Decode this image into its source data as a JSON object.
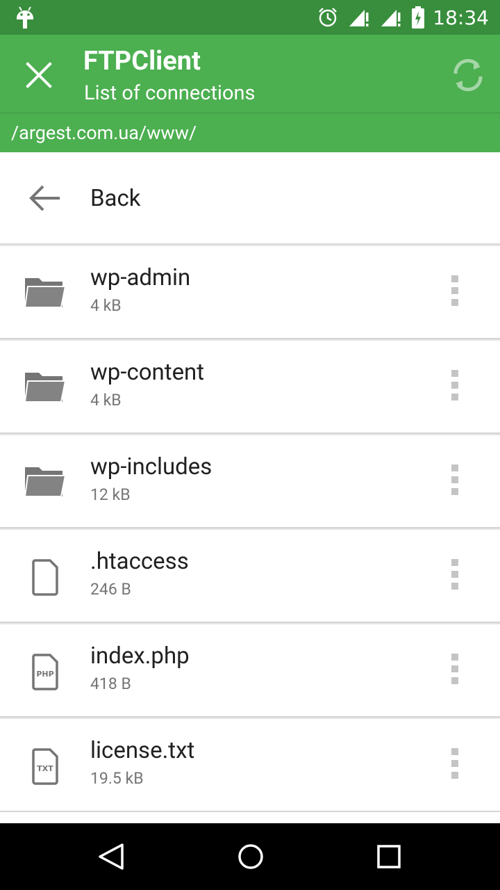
{
  "status_bar": {
    "time": "18:34",
    "icons": [
      "android-icon",
      "alarm-icon",
      "signal-icon",
      "signal-icon",
      "battery-charging-icon"
    ]
  },
  "app_bar": {
    "title": "FTPClient",
    "subtitle": "List of connections",
    "close_icon": "close-icon",
    "refresh_icon": "refresh-icon"
  },
  "path": "/argest.com.ua/www/",
  "back_label": "Back",
  "files": [
    {
      "name": "wp-admin",
      "size": "4 kB",
      "type": "folder"
    },
    {
      "name": "wp-content",
      "size": "4 kB",
      "type": "folder"
    },
    {
      "name": "wp-includes",
      "size": "12 kB",
      "type": "folder"
    },
    {
      "name": ".htaccess",
      "size": "246 B",
      "type": "file"
    },
    {
      "name": "index.php",
      "size": "418 B",
      "type": "php"
    },
    {
      "name": "license.txt",
      "size": "19.5 kB",
      "type": "txt"
    }
  ],
  "file_badges": {
    "php": "PHP",
    "txt": "TXT"
  },
  "colors": {
    "status_bar": "#388e3c",
    "app_bar": "#4caf50",
    "icon_grey": "#757575",
    "divider": "#d4d4d4"
  },
  "nav_bar": [
    "back-nav-icon",
    "home-nav-icon",
    "recents-nav-icon"
  ]
}
